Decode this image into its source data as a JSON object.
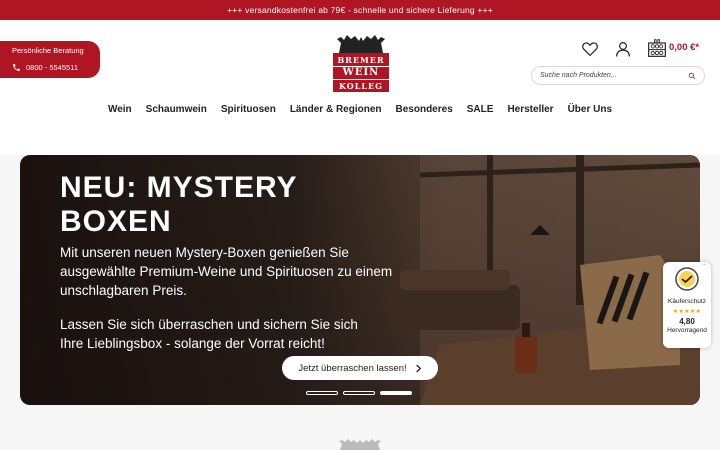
{
  "topbar": {
    "text": "+++ versandkostenfrei ab 79€ - schnelle und sichere Lieferung +++"
  },
  "consult": {
    "label": "Persönliche Beratung",
    "phone": "0800 - 5545511"
  },
  "logo": {
    "line1": "BREMER",
    "line2": "WEIN",
    "line3": "KOLLEG"
  },
  "header": {
    "cart_total": "0,00 €*",
    "wishlist_icon": "heart-icon",
    "account_icon": "user-icon",
    "cart_icon": "wine-rack-icon"
  },
  "search": {
    "placeholder": "Suche nach Produkten..."
  },
  "nav": [
    "Wein",
    "Schaumwein",
    "Spirituosen",
    "Länder & Regionen",
    "Besonderes",
    "SALE",
    "Hersteller",
    "Über Uns"
  ],
  "hero": {
    "title": "NEU: MYSTERY BOXEN",
    "paragraph1": "Mit unseren neuen Mystery-Boxen genießen Sie ausgewählte Premium-Weine und Spirituosen zu einem unschlagbaren Preis.",
    "paragraph2": "Lassen Sie sich überraschen und sichern Sie sich Ihre Lieblingsbox - solange der Vorrat reicht!",
    "cta": "Jetzt überraschen lassen!",
    "slides": 3,
    "active_slide": 3
  },
  "trust": {
    "label": "Käuferschutz",
    "stars": "★★★★★",
    "score": "4,80",
    "rating": "Hervorragend"
  },
  "colors": {
    "brand": "#b01524",
    "accent_star": "#e8a20b"
  }
}
